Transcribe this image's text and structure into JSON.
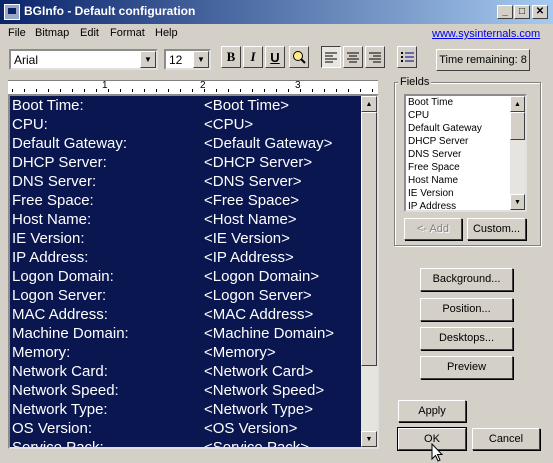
{
  "window": {
    "title": "BGInfo - Default configuration"
  },
  "menu": [
    "File",
    "Bitmap",
    "Edit",
    "Format",
    "Help"
  ],
  "link": "www.sysinternals.com",
  "toolbar": {
    "font": "Arial",
    "size": "12",
    "bold": "B",
    "italic": "I",
    "underline": "U",
    "time_remaining": "Time remaining: 8"
  },
  "ruler": [
    "1",
    "2",
    "3"
  ],
  "editor": {
    "rows": [
      {
        "label": "Boot Time:",
        "value": "<Boot Time>"
      },
      {
        "label": "CPU:",
        "value": "<CPU>"
      },
      {
        "label": "Default Gateway:",
        "value": "<Default Gateway>"
      },
      {
        "label": "DHCP Server:",
        "value": "<DHCP Server>"
      },
      {
        "label": "DNS Server:",
        "value": "<DNS Server>"
      },
      {
        "label": "Free Space:",
        "value": "<Free Space>"
      },
      {
        "label": "Host Name:",
        "value": "<Host Name>"
      },
      {
        "label": "IE Version:",
        "value": "<IE Version>"
      },
      {
        "label": "IP Address:",
        "value": "<IP Address>"
      },
      {
        "label": "Logon Domain:",
        "value": "<Logon Domain>"
      },
      {
        "label": "Logon Server:",
        "value": "<Logon Server>"
      },
      {
        "label": "MAC Address:",
        "value": "<MAC Address>"
      },
      {
        "label": "Machine Domain:",
        "value": "<Machine Domain>"
      },
      {
        "label": "Memory:",
        "value": "<Memory>"
      },
      {
        "label": "Network Card:",
        "value": "<Network Card>"
      },
      {
        "label": "Network Speed:",
        "value": "<Network Speed>"
      },
      {
        "label": "Network Type:",
        "value": "<Network Type>"
      },
      {
        "label": "OS Version:",
        "value": "<OS Version>"
      },
      {
        "label": "Service Pack:",
        "value": "<Service Pack>"
      }
    ]
  },
  "fields": {
    "legend": "Fields",
    "items": [
      "Boot Time",
      "CPU",
      "Default Gateway",
      "DHCP Server",
      "DNS Server",
      "Free Space",
      "Host Name",
      "IE Version",
      "IP Address"
    ],
    "add": "<- Add",
    "custom": "Custom..."
  },
  "buttons": {
    "background": "Background...",
    "position": "Position...",
    "desktops": "Desktops...",
    "preview": "Preview",
    "apply": "Apply",
    "ok": "OK",
    "cancel": "Cancel"
  },
  "colors": {
    "editor_bg": "#0a1650",
    "title_bar": "#0a246a"
  }
}
